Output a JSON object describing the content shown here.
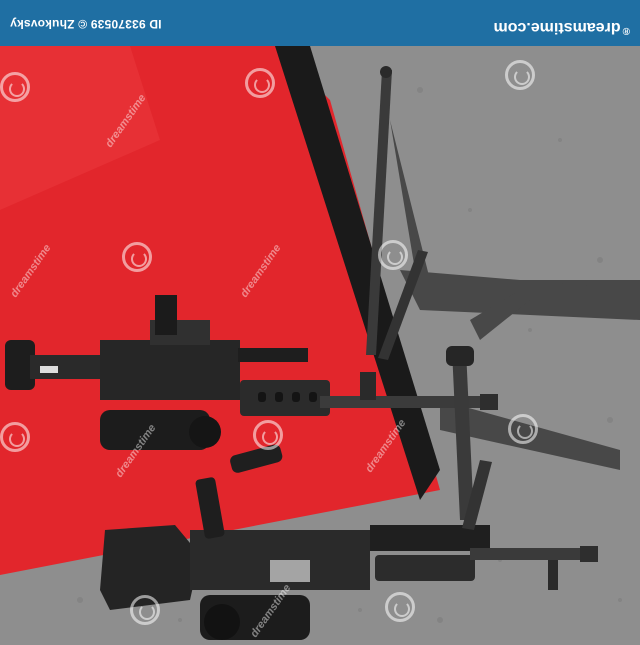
{
  "banner": {
    "id_text": "ID 93370539 © Zhukovsky",
    "logo_text": "dreamstime.com",
    "logo_symbol": "®"
  },
  "watermark": {
    "text": "dreamstime"
  }
}
